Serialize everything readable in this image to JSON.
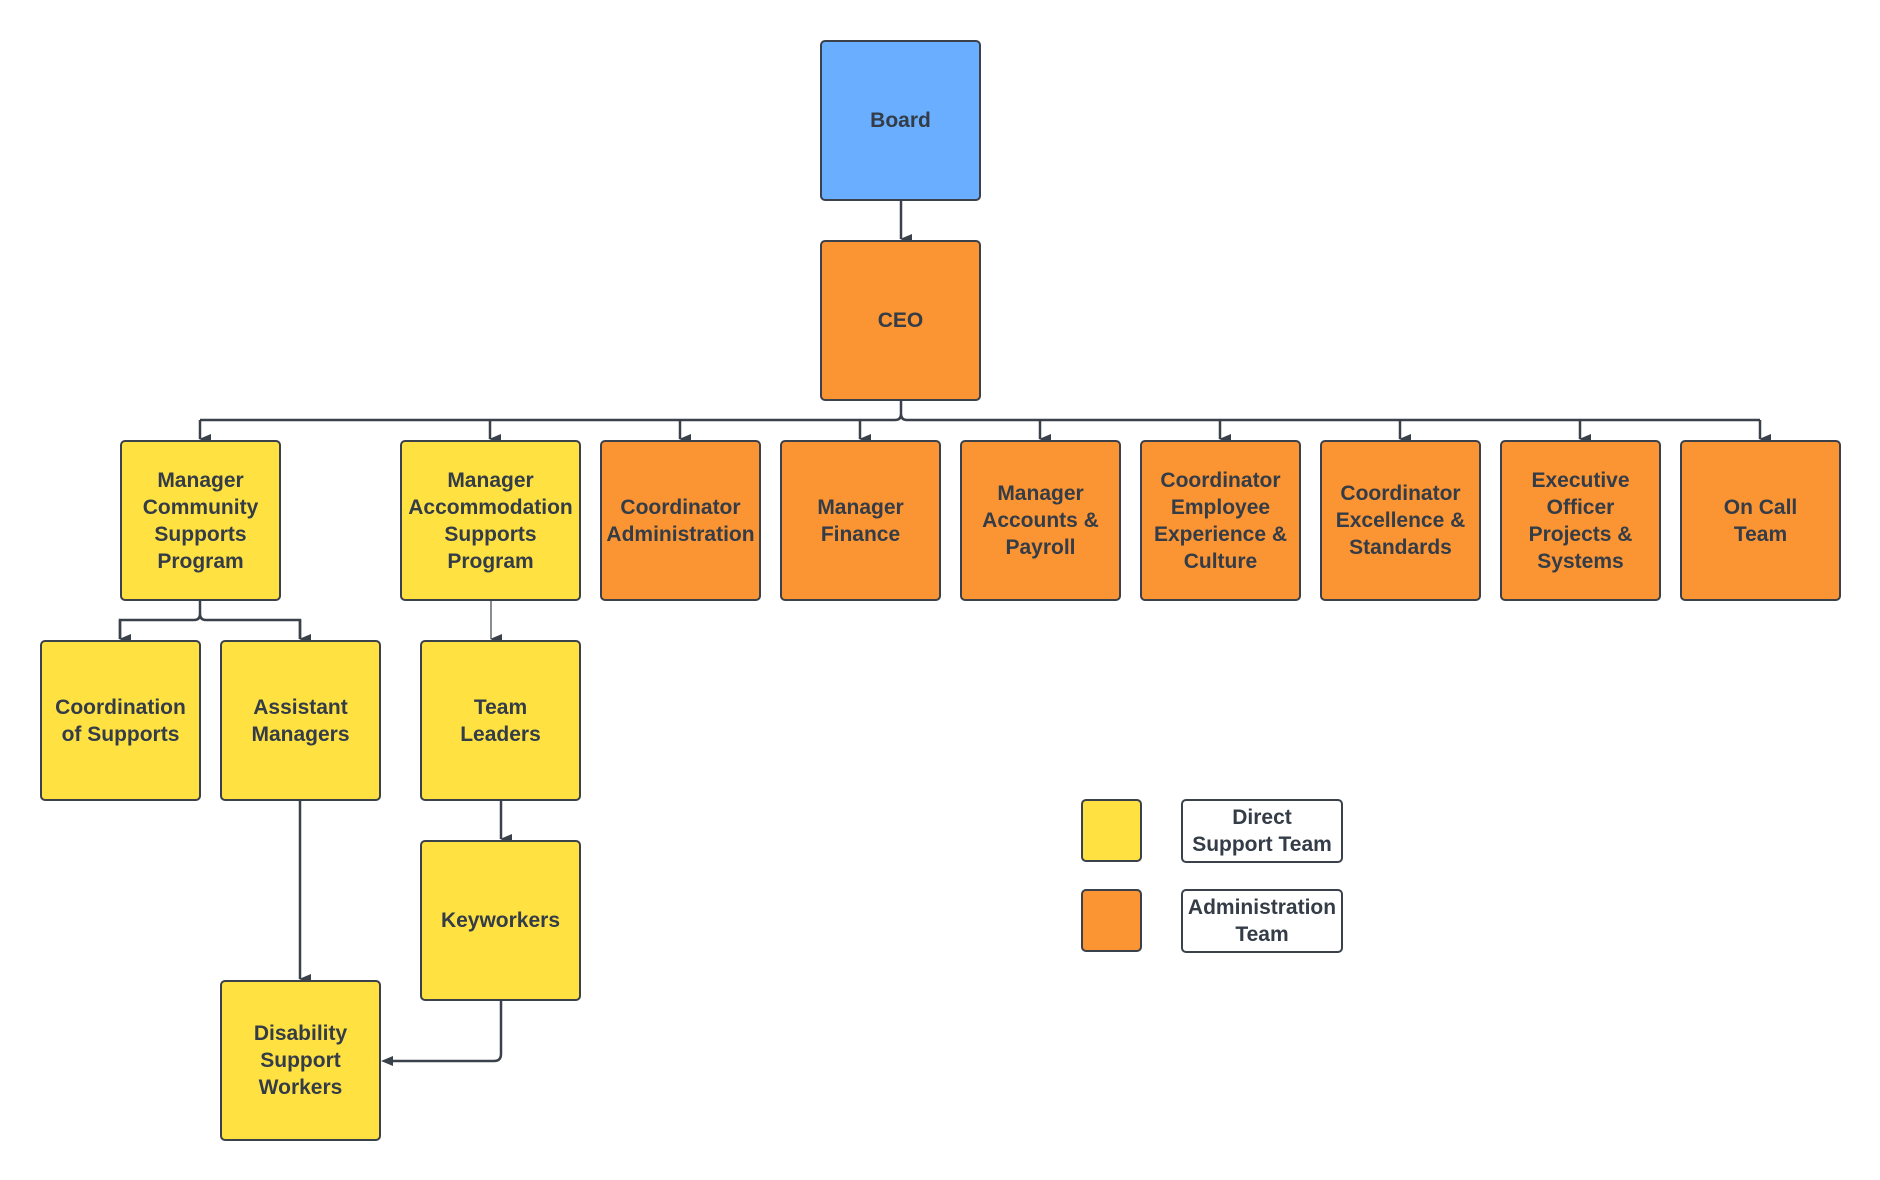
{
  "colors": {
    "board": "#6aafff",
    "administration": "#fb9432",
    "direct_support": "#ffe142",
    "line": "#3a414a"
  },
  "nodes": {
    "board": "Board",
    "ceo": "CEO",
    "manager_community": "Manager\nCommunity\nSupports\nProgram",
    "manager_accommodation": "Manager\nAccommodation\nSupports\nProgram",
    "coordinator_administration": "Coordinator\nAdministration",
    "manager_finance": "Manager\nFinance",
    "manager_accounts": "Manager\nAccounts &\nPayroll",
    "coordinator_employee": "Coordinator\nEmployee\nExperience &\nCulture",
    "coordinator_excellence": "Coordinator\nExcellence &\nStandards",
    "executive_officer": "Executive\nOfficer\nProjects &\nSystems",
    "on_call": "On Call\nTeam",
    "coordination_supports": "Coordination\nof Supports",
    "assistant_managers": "Assistant\nManagers",
    "team_leaders": "Team\nLeaders",
    "keyworkers": "Keyworkers",
    "disability_support_workers": "Disability\nSupport\nWorkers"
  },
  "legend": [
    {
      "label": "Direct\nSupport Team",
      "color": "#ffe142"
    },
    {
      "label": "Administration\nTeam",
      "color": "#fb9432"
    }
  ]
}
